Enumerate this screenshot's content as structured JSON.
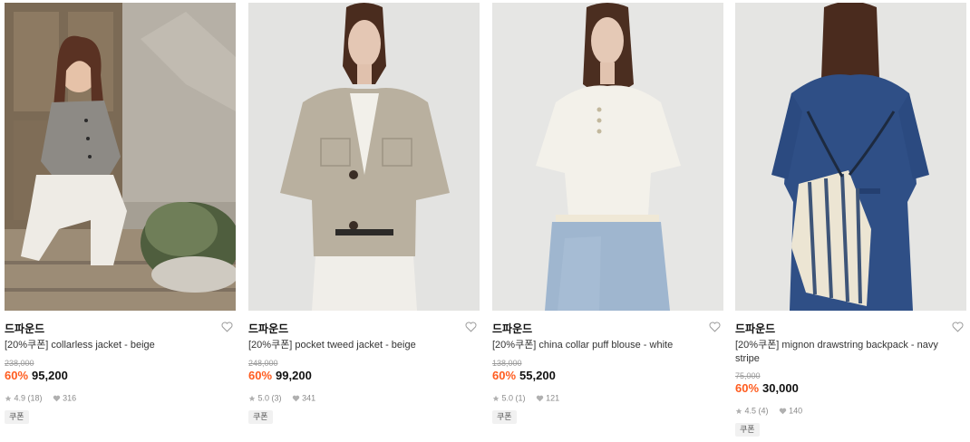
{
  "products": [
    {
      "brand": "드파운드",
      "name": "[20%쿠폰] collarless jacket - beige",
      "original_price": "238,000",
      "discount": "60%",
      "price": "95,200",
      "rating": "4.9",
      "reviews": "(18)",
      "likes": "316",
      "badge": "쿠폰",
      "image": "model-outdoor-collarless-jacket"
    },
    {
      "brand": "드파운드",
      "name": "[20%쿠폰] pocket tweed jacket - beige",
      "original_price": "248,000",
      "discount": "60%",
      "price": "99,200",
      "rating": "5.0",
      "reviews": "(3)",
      "likes": "341",
      "badge": "쿠폰",
      "image": "model-tweed-jacket"
    },
    {
      "brand": "드파운드",
      "name": "[20%쿠폰] china collar puff blouse - white",
      "original_price": "138,000",
      "discount": "60%",
      "price": "55,200",
      "rating": "5.0",
      "reviews": "(1)",
      "likes": "121",
      "badge": "쿠폰",
      "image": "model-white-blouse"
    },
    {
      "brand": "드파운드",
      "name": "[20%쿠폰] mignon drawstring backpack - navy stripe",
      "original_price": "75,000",
      "discount": "60%",
      "price": "30,000",
      "rating": "4.5",
      "reviews": "(4)",
      "likes": "140",
      "badge": "쿠폰",
      "image": "model-striped-backpack"
    }
  ],
  "colors": {
    "discount": "#ff5c1f",
    "price": "#111111",
    "muted": "#9a9a9a",
    "badge_bg": "#f1f1f1"
  }
}
